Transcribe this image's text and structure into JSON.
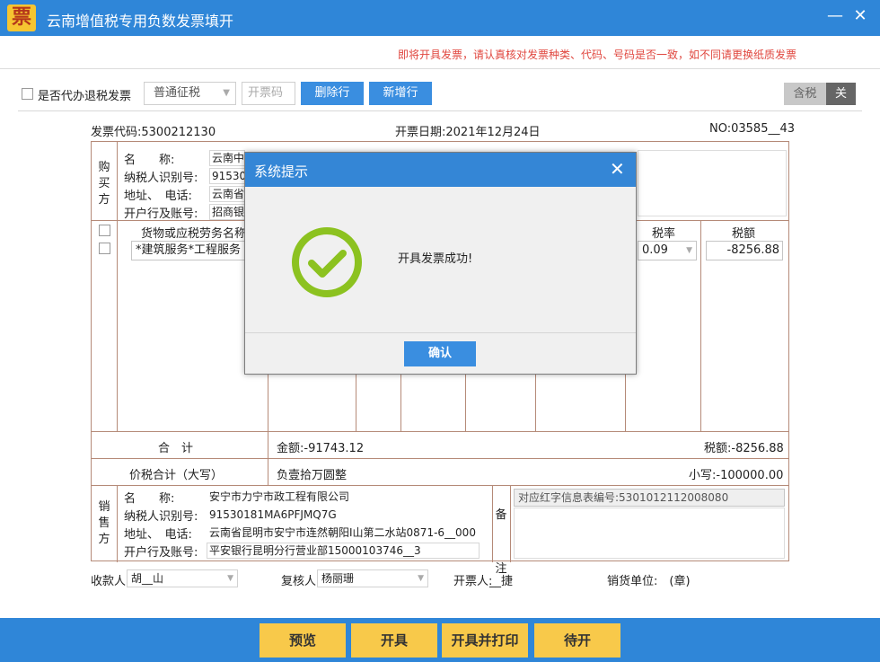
{
  "window": {
    "logo_char": "票",
    "title": "云南增值税专用负数发票填开",
    "minimize": "—",
    "close": "✕"
  },
  "notice": "即将开具发票，请认真核对发票种类、代码、号码是否一致，如不同请更换纸质发票",
  "toolbar": {
    "proxy_refund_label": "是否代办退税发票",
    "tax_type_value": "普通征税",
    "invoice_code_placeholder": "开票码",
    "delete_row": "删除行",
    "add_row": "新增行",
    "tax_included": "含税",
    "tax_toggle": "关"
  },
  "invoice_info": {
    "code": "发票代码:5300212130",
    "date": "开票日期:2021年12月24日",
    "number": "NO:03585__43"
  },
  "buyer": {
    "section_label": [
      "购",
      "买",
      "方"
    ],
    "name_label": "名　　称:",
    "name_value": "云南中",
    "taxid_label": "纳税人识别号:",
    "taxid_value": "91530",
    "addr_label": "地址、　电话:",
    "addr_value": "云南省",
    "bank_label": "开户行及账号:",
    "bank_value": "招商银"
  },
  "goods": {
    "header_name": "货物或应税劳务名称",
    "header_rate": "税率",
    "header_tax": "税额",
    "item_name": "*建筑服务*工程服务",
    "item_rate": "0.09",
    "item_tax": "-8256.88"
  },
  "totals": {
    "total_label": "合　计",
    "amount": "金额:-91743.12",
    "tax": "税额:-8256.88",
    "grand_label": "价税合计（大写）",
    "grand_upper": "负壹拾万圆整",
    "grand_lower": "小写:-100000.00"
  },
  "seller": {
    "section_label": [
      "销",
      "售",
      "方"
    ],
    "name_label": "名　　称:",
    "name_value": "安宁市力宁市政工程有限公司",
    "taxid_label": "纳税人识别号:",
    "taxid_value": "91530181MA6PFJMQ7G",
    "addr_label": "地址、　电话:",
    "addr_value": "云南省昆明市安宁市连然朝阳Ⅰ山第二水站0871-6__000",
    "bank_label": "开户行及账号:",
    "bank_value": "平安银行昆明分行营业部15000103746__3"
  },
  "remarks": {
    "label": [
      "备",
      "注"
    ],
    "text": "对应红字信息表编号:5301012112008080"
  },
  "signatures": {
    "payee_label": "收款人:",
    "payee_value": "胡__山",
    "reviewer_label": "复核人:",
    "reviewer_value": "杨丽珊",
    "issuer_label": "开票人:",
    "issuer_value": "__捷",
    "seller_unit": "销货单位:　(章)"
  },
  "actions": {
    "preview": "预览",
    "issue": "开具",
    "issue_print": "开具并打印",
    "pending": "待开"
  },
  "dialog": {
    "title": "系统提示",
    "close": "✕",
    "message": "开具发票成功!",
    "ok": "确认",
    "icon": "check-circle-icon",
    "icon_color": "#8cc220"
  }
}
